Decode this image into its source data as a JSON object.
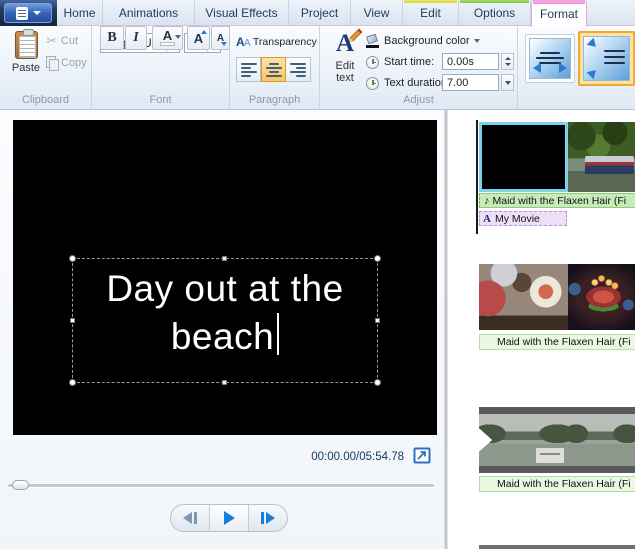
{
  "app": {
    "tabs": [
      {
        "label": "Home"
      },
      {
        "label": "Animations"
      },
      {
        "label": "Visual Effects"
      },
      {
        "label": "Project"
      },
      {
        "label": "View"
      },
      {
        "label": "Edit"
      },
      {
        "label": "Options"
      },
      {
        "label": "Format"
      }
    ],
    "active_tab": "Format"
  },
  "ribbon": {
    "clipboard": {
      "group_label": "Clipboard",
      "paste_label": "Paste",
      "cut_label": "Cut",
      "copy_label": "Copy"
    },
    "font": {
      "group_label": "Font",
      "font_family": "Segoe UI",
      "font_size": "48",
      "bold_glyph": "B",
      "italic_glyph": "I",
      "font_color_glyph": "A",
      "grow_glyph": "A",
      "shrink_glyph": "A"
    },
    "paragraph": {
      "group_label": "Paragraph",
      "transparency_label": "Transparency",
      "transparency_glyph_1": "A",
      "transparency_glyph_2": "A"
    },
    "adjust": {
      "group_label": "Adjust",
      "edit_text_glyph": "A",
      "edit_text_label": "Edit text",
      "background_color_label": "Background color",
      "start_time_label": "Start time:",
      "start_time_value": "0.00s",
      "text_duration_label": "Text duration:",
      "text_duration_value": "7.00"
    }
  },
  "preview": {
    "caption_line1": "Day out at the",
    "caption_line2": "beach",
    "timecode": "00:00.00/05:54.78"
  },
  "storyboard": {
    "music_note_glyph": "♪",
    "text_track_glyph": "A",
    "rows": [
      {
        "music": "Maid with the Flaxen Hair (Fi",
        "text": "My Movie"
      },
      {
        "music": "Maid with the Flaxen Hair (Fi"
      },
      {
        "music": "Maid with the Flaxen Hair (Fi"
      }
    ]
  },
  "colors": {
    "selection_cyan": "#7cd2ec",
    "contextual_yellow": "#e0d94e",
    "contextual_green": "#8fd253",
    "contextual_pink": "#ef9cd9",
    "active_toggle_orange": "#f8c45e",
    "play_blue": "#1580d8",
    "music_track_green": "#c6ebb7",
    "text_track_purple": "#efdef8"
  }
}
